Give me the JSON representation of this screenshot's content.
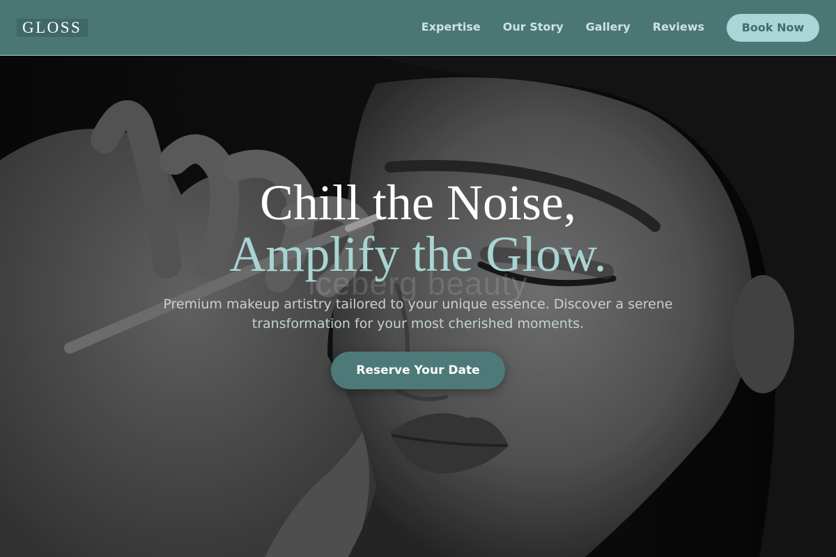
{
  "brand": {
    "logo_text": "GLOSS"
  },
  "nav": {
    "links": [
      {
        "label": "Expertise"
      },
      {
        "label": "Our Story"
      },
      {
        "label": "Gallery"
      },
      {
        "label": "Reviews"
      }
    ],
    "cta_label": "Book Now"
  },
  "hero": {
    "headline_line1": "Chill the Noise,",
    "headline_line2": "Amplify the Glow.",
    "watermark_text": "iceberg beauty",
    "subtitle": "Premium makeup artistry tailored to your unique essence. Discover a serene transformation for your most cherished moments.",
    "cta_label": "Reserve Your Date",
    "background_image": "black-and-white portrait of a woman with eyes closed receiving makeup from an artist's hand"
  },
  "colors": {
    "header_bg": "#4a7674",
    "accent_light": "#a9d6d6",
    "accent_dark": "#4d7a78",
    "headline_accent": "#a8d4d3",
    "text_on_dark": "#ffffff"
  }
}
